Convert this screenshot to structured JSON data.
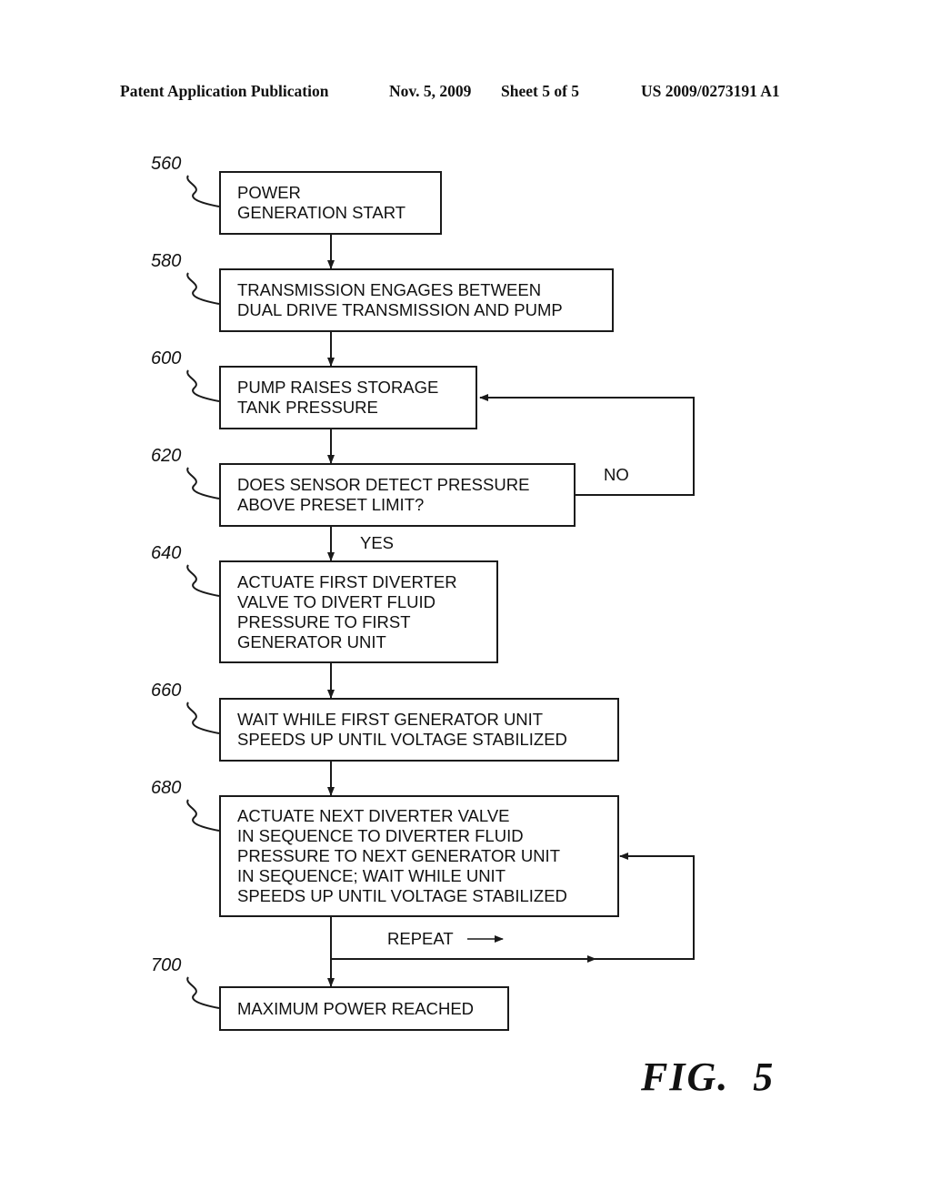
{
  "header": {
    "publication": "Patent Application Publication",
    "date": "Nov. 5, 2009",
    "sheet": "Sheet 5 of 5",
    "number": "US 2009/0273191 A1"
  },
  "steps": [
    {
      "ref": "560",
      "lines": [
        "POWER",
        "GENERATION START"
      ]
    },
    {
      "ref": "580",
      "lines": [
        "TRANSMISSION ENGAGES BETWEEN",
        "DUAL DRIVE TRANSMISSION  AND PUMP"
      ]
    },
    {
      "ref": "600",
      "lines": [
        "PUMP RAISES STORAGE",
        "TANK PRESSURE"
      ]
    },
    {
      "ref": "620",
      "lines": [
        "DOES SENSOR DETECT PRESSURE",
        "ABOVE PRESET LIMIT?"
      ]
    },
    {
      "ref": "640",
      "lines": [
        "ACTUATE FIRST DIVERTER",
        "VALVE TO DIVERT FLUID",
        "PRESSURE TO FIRST",
        "GENERATOR UNIT"
      ]
    },
    {
      "ref": "660",
      "lines": [
        "WAIT WHILE FIRST GENERATOR UNIT",
        "SPEEDS UP UNTIL VOLTAGE STABILIZED"
      ]
    },
    {
      "ref": "680",
      "lines": [
        "ACTUATE NEXT DIVERTER VALVE",
        "IN SEQUENCE TO DIVERTER FLUID",
        "PRESSURE TO NEXT GENERATOR UNIT",
        "IN SEQUENCE; WAIT WHILE UNIT",
        "SPEEDS UP UNTIL VOLTAGE STABILIZED"
      ]
    },
    {
      "ref": "700",
      "lines": [
        "MAXIMUM POWER REACHED"
      ]
    }
  ],
  "branch_labels": {
    "no": "NO",
    "yes": "YES",
    "repeat": "REPEAT"
  },
  "figure_label": "FIG.  5"
}
